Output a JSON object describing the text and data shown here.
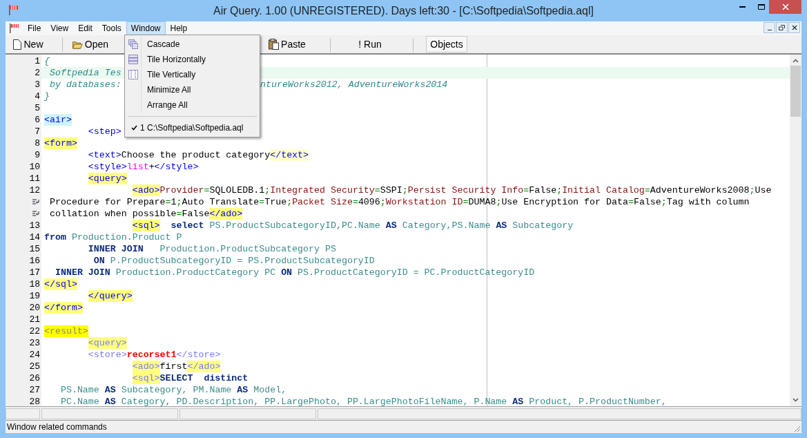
{
  "window": {
    "title": "Air Query. 1.00 (UNREGISTERED). Days left:30 - [C:\\Softpedia\\Softpedia.aql]"
  },
  "menubar": [
    {
      "label": "File",
      "selected": false
    },
    {
      "label": "View",
      "selected": false
    },
    {
      "label": "Edit",
      "selected": false
    },
    {
      "label": "Tools",
      "selected": false
    },
    {
      "label": "Window",
      "selected": true
    },
    {
      "label": "Help",
      "selected": false
    }
  ],
  "toolbar": [
    {
      "label": "New",
      "selected": false
    },
    {
      "label": "Open",
      "selected": false
    },
    {
      "label": "Paste",
      "selected": false
    },
    {
      "label": "! Run",
      "selected": false
    },
    {
      "label": "Objects",
      "selected": true
    }
  ],
  "window_menu": [
    {
      "kind": "item",
      "label": "Cascade"
    },
    {
      "kind": "item",
      "label": "Tile Horizontally"
    },
    {
      "kind": "item",
      "label": "Tile Vertically"
    },
    {
      "kind": "item",
      "label": "Minimize All"
    },
    {
      "kind": "item",
      "label": "Arrange All"
    },
    {
      "kind": "separator"
    },
    {
      "kind": "item",
      "label": "1 C:\\Softpedia\\Softpedia.aql",
      "checked": true
    }
  ],
  "editor": {
    "lines": [
      {
        "num": "1",
        "current": false,
        "tokens": [
          {
            "t": "{",
            "kind": "comment"
          }
        ]
      },
      {
        "num": "2",
        "current": true,
        "tokens": [
          {
            "t": " Softpedia Tes",
            "kind": "comment"
          }
        ]
      },
      {
        "num": "3",
        "current": false,
        "tokens": [
          {
            "t": " by databases:",
            "kind": "comment"
          },
          {
            "t": "ntureWorks2012, AdventureWorks2014",
            "kind": "comment",
            "resume": true
          }
        ]
      },
      {
        "num": "4",
        "current": false,
        "tokens": [
          {
            "t": "}",
            "kind": "comment"
          }
        ]
      },
      {
        "num": "5",
        "current": false
      },
      {
        "num": "6",
        "current": false,
        "tokens": [
          {
            "t": "<air>",
            "kind": "tag_cyan"
          }
        ]
      },
      {
        "num": "7",
        "current": false,
        "tokens": [
          {
            "t": "        <step>",
            "kind": "tag"
          }
        ]
      },
      {
        "num": "8",
        "current": false,
        "tokens": [
          {
            "t": "<form>",
            "kind": "tag_marked"
          }
        ]
      },
      {
        "num": "9",
        "current": false,
        "tokens": [
          {
            "t": "        <text>",
            "kind": "tag"
          },
          {
            "t": "Choose the product category",
            "kind": "text"
          },
          {
            "t": "</text>",
            "kind": "tag_pale"
          }
        ]
      },
      {
        "num": "10",
        "current": false,
        "tokens": [
          {
            "t": "        <style>",
            "kind": "tag"
          },
          {
            "t": "list",
            "kind": "magenta"
          },
          {
            "t": "+",
            "kind": "text"
          },
          {
            "t": "</style>",
            "kind": "tag"
          }
        ]
      },
      {
        "num": "11",
        "current": false,
        "tokens": [
          {
            "t": "        <query>",
            "kind": "tag_marked"
          }
        ]
      },
      {
        "num": "12",
        "current": false,
        "tokens": [
          {
            "t": "                <ado>",
            "kind": "tag_marked"
          },
          {
            "t": "Provider",
            "kind": "attr"
          },
          {
            "t": "=",
            "kind": "eq"
          },
          {
            "t": "SQLOLEDB.1",
            "kind": "text"
          },
          {
            "t": ";",
            "kind": "eq"
          },
          {
            "t": "Integrated Security",
            "kind": "attr"
          },
          {
            "t": "=",
            "kind": "eq"
          },
          {
            "t": "SSPI",
            "kind": "text"
          },
          {
            "t": ";",
            "kind": "eq"
          },
          {
            "t": "Persist Security Info",
            "kind": "attr"
          },
          {
            "t": "=",
            "kind": "eq"
          },
          {
            "t": "False",
            "kind": "text"
          },
          {
            "t": ";",
            "kind": "eq"
          },
          {
            "t": "Initial Catalog",
            "kind": "attr"
          },
          {
            "t": "=",
            "kind": "eq"
          },
          {
            "t": "AdventureWorks2008",
            "kind": "text"
          },
          {
            "t": ";",
            "kind": "eq"
          },
          {
            "t": "Use",
            "kind": "text"
          }
        ]
      },
      {
        "wrapped": true,
        "current": false,
        "tokens": [
          {
            "t": " Procedure for Prepare",
            "kind": "text"
          },
          {
            "t": "=",
            "kind": "eq"
          },
          {
            "t": "1",
            "kind": "text"
          },
          {
            "t": ";",
            "kind": "eq"
          },
          {
            "t": "Auto Translate",
            "kind": "text"
          },
          {
            "t": "=",
            "kind": "eq"
          },
          {
            "t": "True",
            "kind": "text"
          },
          {
            "t": ";",
            "kind": "eq"
          },
          {
            "t": "Packet Size",
            "kind": "attr"
          },
          {
            "t": "=",
            "kind": "eq"
          },
          {
            "t": "4096",
            "kind": "text"
          },
          {
            "t": ";",
            "kind": "eq"
          },
          {
            "t": "Workstation ID",
            "kind": "attr"
          },
          {
            "t": "=",
            "kind": "eq"
          },
          {
            "t": "DUMA8",
            "kind": "text"
          },
          {
            "t": ";",
            "kind": "eq"
          },
          {
            "t": "Use Encryption for Data",
            "kind": "text"
          },
          {
            "t": "=",
            "kind": "eq"
          },
          {
            "t": "False",
            "kind": "text"
          },
          {
            "t": ";",
            "kind": "eq"
          },
          {
            "t": "Tag with column",
            "kind": "text"
          }
        ]
      },
      {
        "wrapped": true,
        "current": false,
        "tokens": [
          {
            "t": " collation when possible",
            "kind": "text"
          },
          {
            "t": "=",
            "kind": "eq"
          },
          {
            "t": "False",
            "kind": "text"
          },
          {
            "t": "</ado>",
            "kind": "tag_marked"
          }
        ]
      },
      {
        "num": "13",
        "current": false,
        "tokens": [
          {
            "t": "                <sql>",
            "kind": "tag_marked"
          },
          {
            "t": "  select",
            "kind": "kw"
          },
          {
            "t": " PS.ProductSubcategoryID,PC.Name",
            "kind": "id"
          },
          {
            "t": " AS",
            "kind": "kw"
          },
          {
            "t": " Category,PS.Name",
            "kind": "id"
          },
          {
            "t": " AS",
            "kind": "kw"
          },
          {
            "t": " Subcategory",
            "kind": "id"
          }
        ]
      },
      {
        "num": "14",
        "current": false,
        "tokens": [
          {
            "t": "from",
            "kind": "kw"
          },
          {
            "t": " Production.Product P",
            "kind": "id"
          }
        ]
      },
      {
        "num": "15",
        "current": false,
        "tokens": [
          {
            "t": "        INNER JOIN",
            "kind": "kw"
          },
          {
            "t": "   Production.ProductSubcategory PS",
            "kind": "id"
          }
        ]
      },
      {
        "num": "16",
        "current": false,
        "tokens": [
          {
            "t": "         ON",
            "kind": "kw"
          },
          {
            "t": " P.ProductSubcategoryID = PS.ProductSubcategoryID",
            "kind": "id"
          }
        ]
      },
      {
        "num": "17",
        "current": false,
        "tokens": [
          {
            "t": "  INNER JOIN",
            "kind": "kw"
          },
          {
            "t": " Production.ProductCategory PC",
            "kind": "id"
          },
          {
            "t": " ON",
            "kind": "kw"
          },
          {
            "t": " PS.ProductCategoryID = PC.ProductCategoryID",
            "kind": "id"
          }
        ]
      },
      {
        "num": "18",
        "current": false,
        "tokens": [
          {
            "t": "</sql>",
            "kind": "tag_marked"
          }
        ]
      },
      {
        "num": "19",
        "current": false,
        "tokens": [
          {
            "t": "        </query>",
            "kind": "tag_marked"
          }
        ]
      },
      {
        "num": "20",
        "current": false,
        "tokens": [
          {
            "t": "</form>",
            "kind": "tag_marked"
          }
        ]
      },
      {
        "num": "21",
        "current": false
      },
      {
        "num": "22",
        "current": false,
        "tokens": [
          {
            "t": "<result>",
            "kind": "tag_bright"
          }
        ]
      },
      {
        "num": "23",
        "current": false,
        "tokens": [
          {
            "t": "        <query>",
            "kind": "tag_dim_marked"
          }
        ]
      },
      {
        "num": "24",
        "current": false,
        "tokens": [
          {
            "t": "        <store>",
            "kind": "tag_dim"
          },
          {
            "t": "recorset1",
            "kind": "str"
          },
          {
            "t": "</store>",
            "kind": "tag_dim"
          }
        ]
      },
      {
        "num": "25",
        "current": false,
        "tokens": [
          {
            "t": "                <ado>",
            "kind": "tag_dim_marked"
          },
          {
            "t": "first",
            "kind": "text"
          },
          {
            "t": "</ado>",
            "kind": "tag_dim_marked"
          }
        ]
      },
      {
        "num": "26",
        "current": false,
        "tokens": [
          {
            "t": "                <sql>",
            "kind": "tag_dim_marked"
          },
          {
            "t": "SELECT  distinct",
            "kind": "kw"
          }
        ]
      },
      {
        "num": "27",
        "current": false,
        "tokens": [
          {
            "t": "   PS.Name",
            "kind": "id"
          },
          {
            "t": " AS",
            "kind": "kw"
          },
          {
            "t": " Subcategory, PM.Name",
            "kind": "id"
          },
          {
            "t": " AS",
            "kind": "kw"
          },
          {
            "t": " Model,",
            "kind": "id"
          }
        ]
      },
      {
        "num": "28",
        "current": false,
        "tokens": [
          {
            "t": "   PC.Name",
            "kind": "id"
          },
          {
            "t": " AS",
            "kind": "kw"
          },
          {
            "t": " Category, PD.Description, PP.LargePhoto, PP.LargePhotoFileName, P.Name",
            "kind": "id"
          },
          {
            "t": " AS",
            "kind": "kw"
          },
          {
            "t": " Product, P.ProductNumber,",
            "kind": "id"
          }
        ]
      }
    ]
  },
  "status_bar": {
    "message": "Window related commands"
  }
}
